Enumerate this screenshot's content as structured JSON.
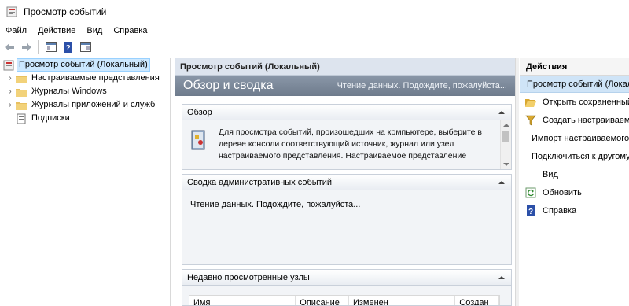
{
  "window": {
    "title": "Просмотр событий"
  },
  "menu": [
    "Файл",
    "Действие",
    "Вид",
    "Справка"
  ],
  "toolbar": {
    "buttons": [
      "back-icon",
      "forward-icon",
      "show-hide-tree-icon",
      "help-icon",
      "show-hide-action-pane-icon"
    ]
  },
  "tree": {
    "items": [
      {
        "label": "Просмотр событий (Локальный)",
        "expander": "",
        "icon": "event-viewer-icon",
        "selected": true
      },
      {
        "label": "Настраиваемые представления",
        "expander": "›",
        "icon": "folder-icon"
      },
      {
        "label": "Журналы Windows",
        "expander": "›",
        "icon": "folder-icon"
      },
      {
        "label": "Журналы приложений и служб",
        "expander": "›",
        "icon": "folder-icon"
      },
      {
        "label": "Подписки",
        "expander": "",
        "icon": "subscriptions-icon"
      }
    ]
  },
  "center": {
    "header": "Просмотр событий (Локальный)",
    "summary_title": "Обзор и сводка",
    "summary_status": "Чтение данных. Подождите, пожалуйста...",
    "overview": {
      "title": "Обзор",
      "text": "Для просмотра событий, произошедших на компьютере, выберите в дереве консоли соответствующий источник, журнал или узел настраиваемого представления. Настраиваемое представление \"События управления\" включает все события"
    },
    "admin_summary": {
      "title": "Сводка административных событий",
      "text": "Чтение данных. Подождите, пожалуйста..."
    },
    "recent": {
      "title": "Недавно просмотренные узлы",
      "columns": [
        "Имя",
        "Описание",
        "Изменен",
        "Создан"
      ]
    }
  },
  "actions": {
    "header": "Действия",
    "section": "Просмотр событий (Локальный)",
    "items": [
      {
        "label": "Открыть сохраненный журнал...",
        "icon": "open-folder-icon"
      },
      {
        "label": "Создать настраиваемое представление...",
        "icon": "filter-icon"
      },
      {
        "label": "Импорт настраиваемого представления...",
        "icon": ""
      },
      {
        "label": "Подключиться к другому компьютеру...",
        "icon": ""
      },
      {
        "label": "Вид",
        "icon": ""
      },
      {
        "label": "Обновить",
        "icon": "refresh-icon"
      },
      {
        "label": "Справка",
        "icon": "help-icon"
      }
    ]
  }
}
